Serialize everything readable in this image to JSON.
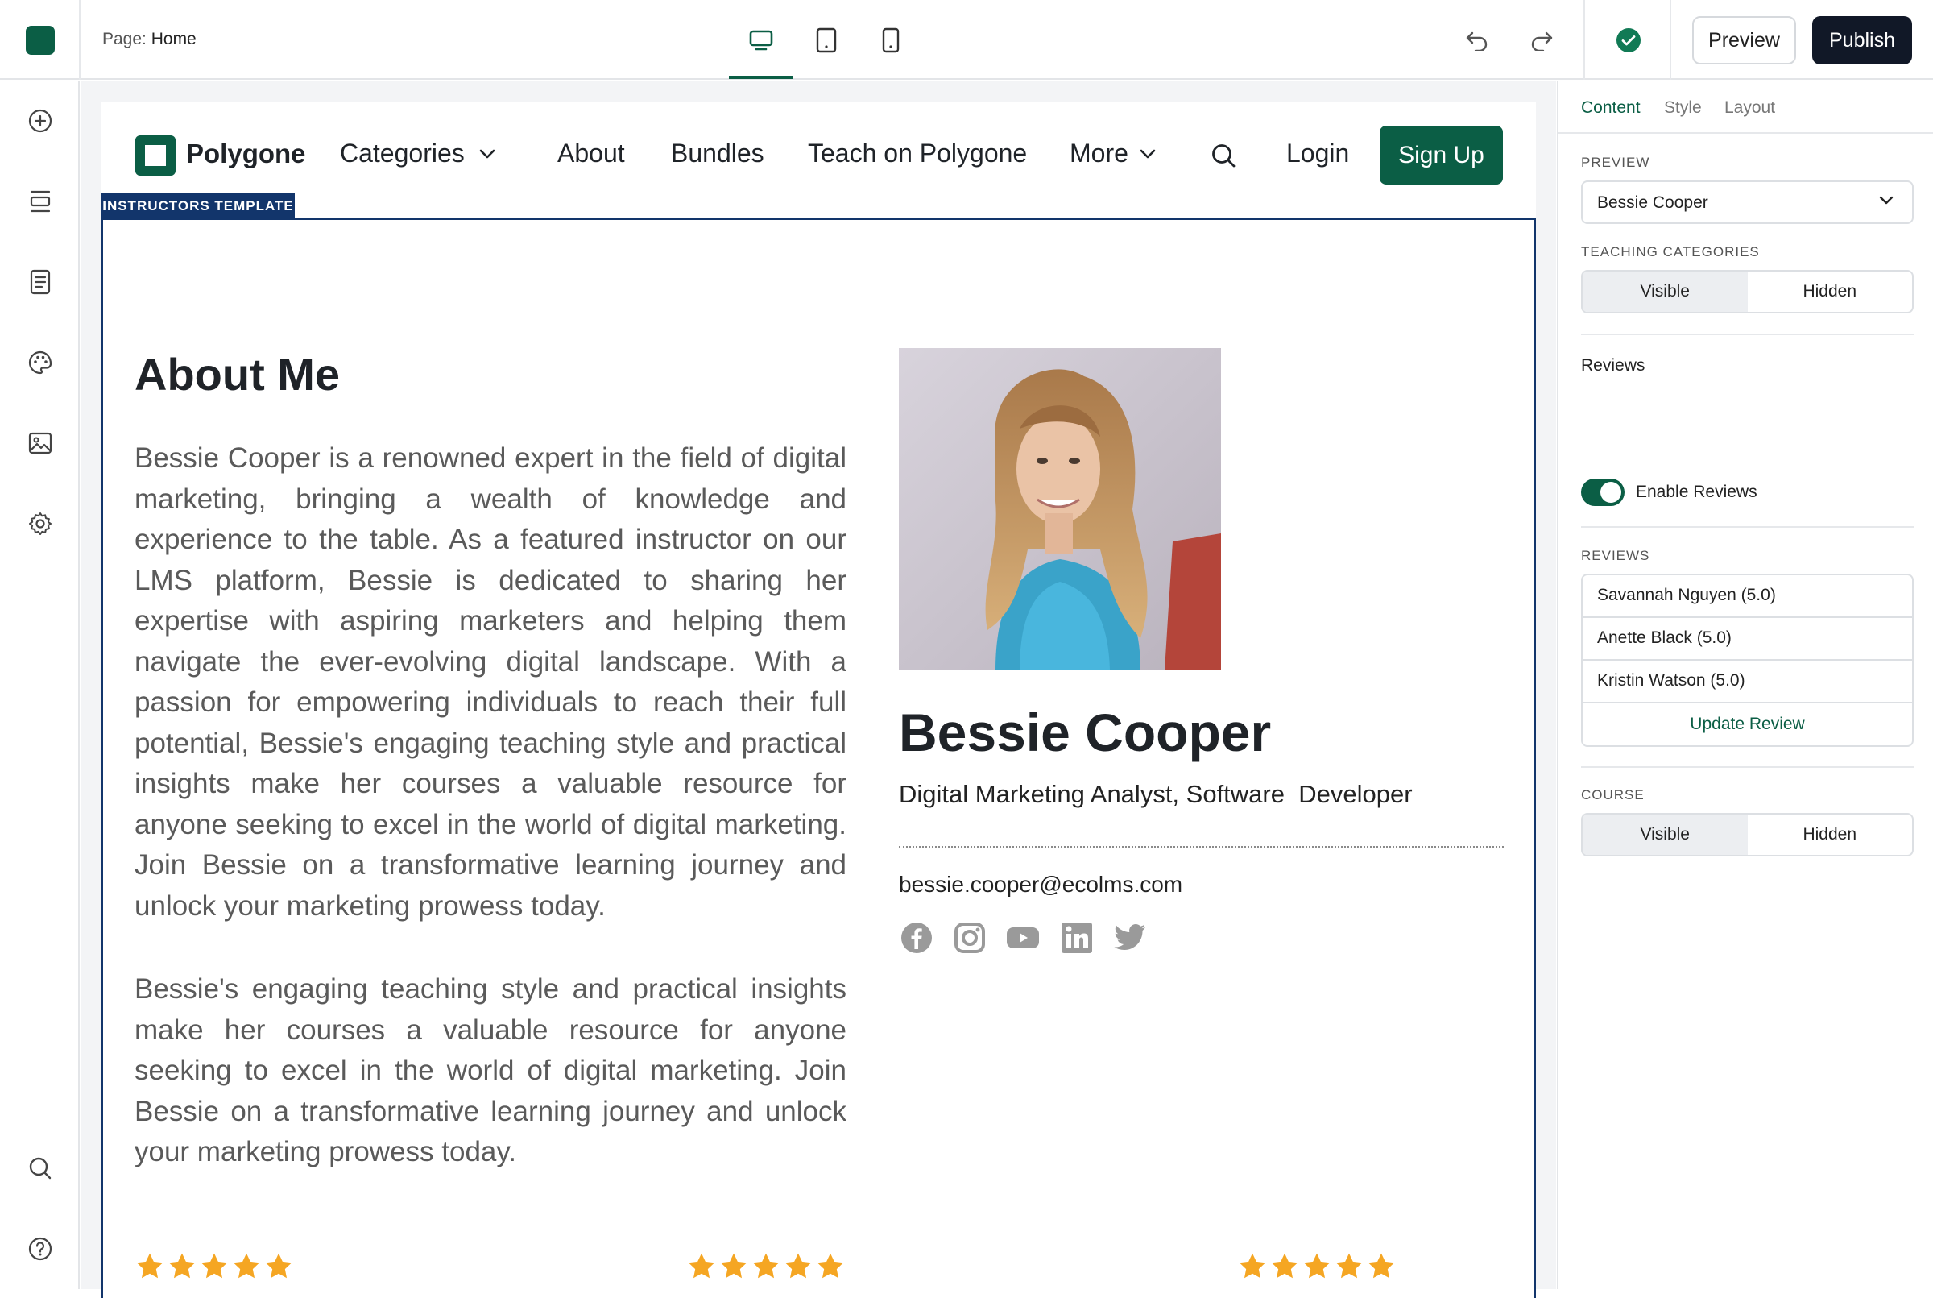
{
  "app": {
    "brand_color": "#0b5e45",
    "page_label_prefix": "Page: ",
    "page_name": "Home"
  },
  "toolbar": {
    "devices": [
      "desktop-icon",
      "tablet-icon",
      "mobile-icon"
    ],
    "preview_label": "Preview",
    "publish_label": "Publish",
    "status": "saved"
  },
  "left_sidebar": {
    "icons": [
      "add-icon",
      "sections-icon",
      "pages-icon",
      "theme-palette-icon",
      "media-icon",
      "settings-icon",
      "search-icon",
      "help-icon"
    ]
  },
  "site": {
    "brand": "Polygone",
    "nav": {
      "categories": "Categories",
      "about": "About",
      "bundles": "Bundles",
      "teach": "Teach on Polygone",
      "more": "More",
      "login": "Login",
      "signup": "Sign Up"
    },
    "template_tag": "INSTRUCTORS TEMPLATE",
    "about": {
      "title": "About Me",
      "paragraph1": "Bessie Cooper is a renowned expert in the field of digital marketing, bringing a wealth of knowledge and experience to the table. As a featured instructor on our LMS platform, Bessie is dedicated to sharing her expertise with aspiring marketers and helping them navigate the ever-evolving digital landscape. With a passion for empowering individuals to reach their full potential, Bessie's engaging teaching style and practical insights make her courses a valuable resource for anyone seeking to excel in the world of digital marketing. Join Bessie on a transformative learning journey and unlock your marketing prowess today.",
      "paragraph2": "Bessie's engaging teaching style and practical insights make her courses a valuable resource for anyone seeking to excel in the world of digital marketing. Join Bessie on a transformative learning journey and unlock your marketing prowess today."
    },
    "instructor": {
      "name": "Bessie Cooper",
      "role": "Digital Marketing Analyst, Software  Developer",
      "email": "bessie.cooper@ecolms.com",
      "socials": [
        "facebook-icon",
        "instagram-icon",
        "youtube-icon",
        "linkedin-icon",
        "twitter-icon"
      ]
    },
    "review_ratings": [
      5,
      5,
      5
    ],
    "star_color": "#f5a623"
  },
  "panel": {
    "tabs": [
      "Content",
      "Style",
      "Layout"
    ],
    "preview_label": "PREVIEW",
    "preview_value": "Bessie Cooper",
    "teaching_categories_label": "TEACHING CATEGORIES",
    "visible": "Visible",
    "hidden": "Hidden",
    "reviews_section": "Reviews",
    "enable_reviews": "Enable Reviews",
    "reviews_label": "REVIEWS",
    "reviews": [
      "Savannah Nguyen (5.0)",
      "Anette Black (5.0)",
      "Kristin Watson (5.0)"
    ],
    "update_review": "Update Review",
    "course_label": "COURSE"
  }
}
